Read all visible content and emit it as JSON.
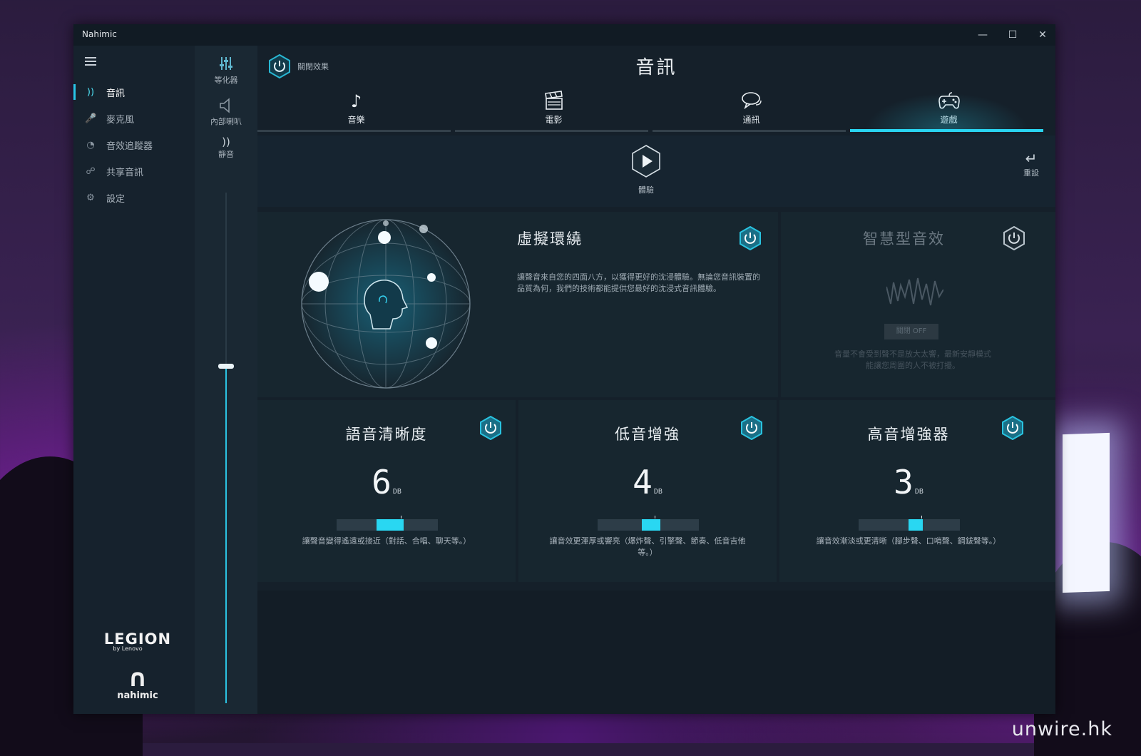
{
  "window": {
    "title": "Nahimic"
  },
  "watermark": "unwire.hk",
  "sidebar": {
    "items": [
      {
        "label": "音訊",
        "icon": "speaker-waves-icon",
        "active": true
      },
      {
        "label": "麥克風",
        "icon": "microphone-icon",
        "active": false
      },
      {
        "label": "音效追蹤器",
        "icon": "radar-icon",
        "active": false
      },
      {
        "label": "共享音訊",
        "icon": "share-icon",
        "active": false
      },
      {
        "label": "設定",
        "icon": "gear-icon",
        "active": false
      }
    ],
    "brand_legion": "LEGION",
    "brand_legion_sub": "by Lenovo",
    "brand_nahimic": "nahimic"
  },
  "devices": {
    "items": [
      {
        "label": "等化器",
        "icon": "equalizer-icon"
      },
      {
        "label": "內部喇叭",
        "icon": "speaker-icon"
      },
      {
        "label": "靜音",
        "icon": "mute-icon"
      }
    ],
    "volume_level": 0.33
  },
  "header": {
    "close_effect_label": "關閉效果",
    "title": "音訊"
  },
  "tabs": [
    {
      "label": "音樂",
      "icon": "music-note-icon",
      "active": false
    },
    {
      "label": "電影",
      "icon": "clapperboard-icon",
      "active": false
    },
    {
      "label": "通訊",
      "icon": "chat-bubble-icon",
      "active": false
    },
    {
      "label": "遊戲",
      "icon": "gamepad-icon",
      "active": true
    }
  ],
  "play": {
    "label": "體驗"
  },
  "reset": {
    "label": "重設"
  },
  "virtual_surround": {
    "title": "虛擬環繞",
    "desc": "讓聲音來自您的四面八方，以獲得更好的沈浸體驗。無論您音訊裝置的品質為何，我們的技術都能提供您最好的沈浸式音訊體驗。"
  },
  "smart_volume": {
    "title": "智慧型音效",
    "button": "關閉 OFF",
    "desc": "音量不會受到聲不是放大太響，最新安靜模式能讓您周圍的人不被打擾。"
  },
  "effects": [
    {
      "title": "語音清晰度",
      "value": "6",
      "unit": "DB",
      "level": 0.45,
      "desc": "讓聲音變得遙遠或接近（對話、合唱、聊天等。）"
    },
    {
      "title": "低音增強",
      "value": "4",
      "unit": "DB",
      "level": 0.5,
      "desc": "讓音效更渾厚或響亮（爆炸聲、引擎聲、節奏、低音吉他等。）"
    },
    {
      "title": "高音增強器",
      "value": "3",
      "unit": "DB",
      "level": 0.57,
      "desc": "讓音效漸淡或更清晰（腳步聲、口哨聲、鋼鈸聲等。）"
    }
  ],
  "colors": {
    "accent": "#29d4f0",
    "panel": "#17262f",
    "background": "#15202a"
  }
}
